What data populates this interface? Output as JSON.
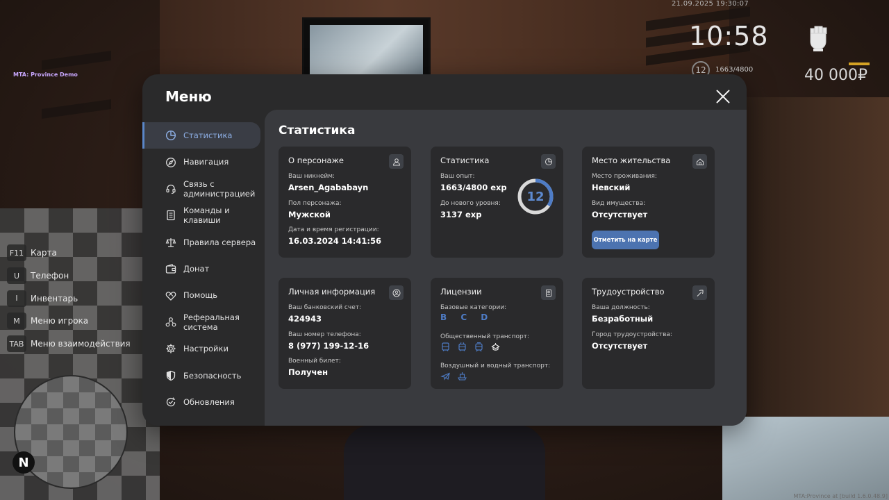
{
  "hud": {
    "datetime": "21.09.2025 19:30:07",
    "time": "10:58",
    "level": "12",
    "exp": "1663/4800",
    "money": "40 000₽",
    "server_label": "MTA: Province Demo",
    "footer": "MTA:Province at [build 1.6.0.48.9]",
    "compass": "N"
  },
  "hotkeys": [
    {
      "key": "F11",
      "label": "Карта"
    },
    {
      "key": "U",
      "label": "Телефон"
    },
    {
      "key": "I",
      "label": "Инвентарь"
    },
    {
      "key": "M",
      "label": "Меню игрока"
    },
    {
      "key": "TAB",
      "label": "Меню взаимодействия"
    }
  ],
  "menu": {
    "title": "Меню",
    "sidebar": [
      {
        "label": "Статистика",
        "icon": "pie-chart-icon",
        "active": true
      },
      {
        "label": "Навигация",
        "icon": "compass-icon"
      },
      {
        "label": "Связь с администрацией",
        "icon": "headset-icon"
      },
      {
        "label": "Команды и клавиши",
        "icon": "document-icon"
      },
      {
        "label": "Правила сервера",
        "icon": "scales-icon"
      },
      {
        "label": "Донат",
        "icon": "wallet-icon"
      },
      {
        "label": "Помощь",
        "icon": "handshake-icon"
      },
      {
        "label": "Реферальная система",
        "icon": "network-icon"
      },
      {
        "label": "Настройки",
        "icon": "gear-icon"
      },
      {
        "label": "Безопасность",
        "icon": "shield-icon"
      },
      {
        "label": "Обновления",
        "icon": "refresh-check-icon"
      }
    ],
    "content_title": "Статистика",
    "cards": {
      "character": {
        "title": "О персонаже",
        "nickname_label": "Ваш никнейм:",
        "nickname": "Arsen_Agababayn",
        "gender_label": "Пол персонажа:",
        "gender": "Мужской",
        "reg_label": "Дата и время регистрации:",
        "reg_date": "16.03.2024 14:41:56"
      },
      "stats": {
        "title": "Статистика",
        "exp_label": "Ваш опыт:",
        "exp": "1663/4800 exp",
        "next_label": "До нового уровня:",
        "next": "3137 exp",
        "level": "12",
        "progress": 0.346
      },
      "residence": {
        "title": "Место жительства",
        "place_label": "Место проживания:",
        "place": "Невский",
        "property_label": "Вид имущества:",
        "property": "Отсутствует",
        "map_button": "Отметить на карте"
      },
      "personal": {
        "title": "Личная информация",
        "bank_label": "Ваш банковский счет:",
        "bank": "424943",
        "phone_label": "Ваш номер телефона:",
        "phone": "8 (977) 199-12-16",
        "military_label": "Военный билет:",
        "military": "Получен"
      },
      "licenses": {
        "title": "Лицензии",
        "base_label": "Базовые категории:",
        "base_categories": "B C D",
        "public_label": "Общественный транспорт:",
        "air_label": "Воздушный и водный транспорт:"
      },
      "employment": {
        "title": "Трудоустройство",
        "position_label": "Ваша должность:",
        "position": "Безработный",
        "city_label": "Город трудоустройства:",
        "city": "Отсутствует"
      }
    }
  },
  "colors": {
    "accent": "#5a86c8",
    "button": "#4c73b0",
    "panel": "#2a2a2b",
    "content": "#393a3e",
    "card": "#2a2a2c",
    "money_bar": "#d4a224"
  }
}
